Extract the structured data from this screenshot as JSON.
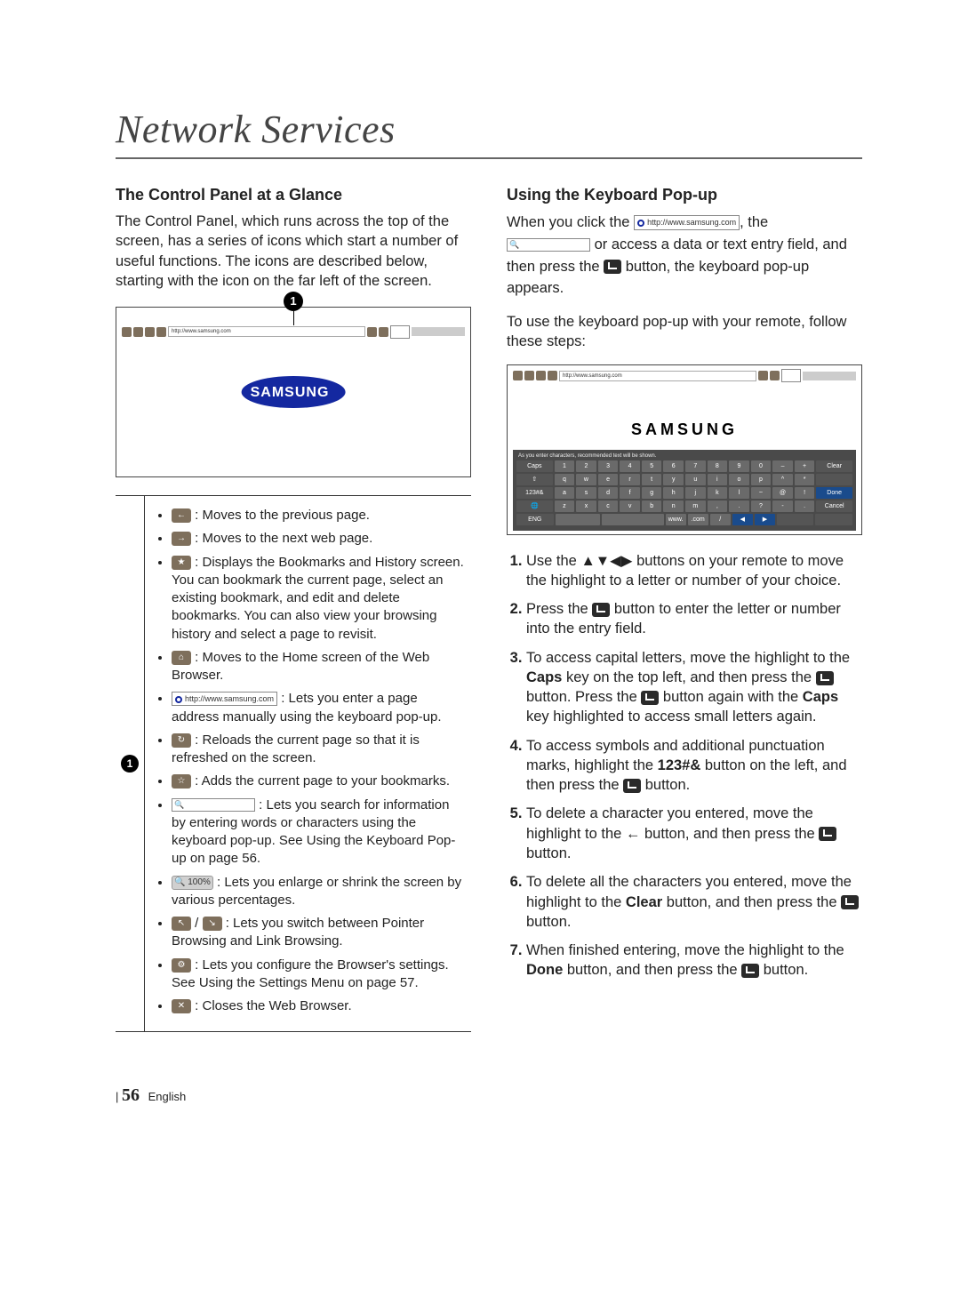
{
  "chapter": "Network Services",
  "left": {
    "heading": "The Control Panel at a Glance",
    "intro": "The Control Panel, which runs across the top of the screen, has a series of icons which start a number of useful functions. The icons are described below, starting with the icon on the far left of the screen.",
    "callout_num": "1",
    "toolbar_url": "http://www.samsung.com",
    "logo_text": "SAMSUNG",
    "list_num": "1",
    "items": {
      "i1": ": Moves to the previous page.",
      "i2": ": Moves to the next web page.",
      "i3": ": Displays the Bookmarks and History screen. You can bookmark the current page, select an existing bookmark, and edit and delete bookmarks. You can also view your browsing history and select a page to revisit.",
      "i4": ": Moves to the Home screen of the Web Browser.",
      "i5_url": "http://www.samsung.com",
      "i5": " : Lets you enter a page address manually using the keyboard pop-up.",
      "i6": ": Reloads the current page so that it is refreshed on the screen.",
      "i7": ": Adds the current page to your bookmarks.",
      "i8": " : Lets you search for information by entering words or characters using the keyboard pop-up. See Using the Keyboard Pop-up on page 56.",
      "i9_label": "100%",
      "i9": " : Lets you enlarge or shrink the screen by various percentages.",
      "i10": ": Lets you switch between Pointer Browsing and Link Browsing.",
      "i11": ": Lets you configure the Browser's settings. See Using the Settings Menu on page 57.",
      "i12": ": Closes the Web Browser."
    }
  },
  "right": {
    "heading": "Using the Keyboard Pop-up",
    "p1a": "When you click the ",
    "p1_url": "http://www.samsung.com",
    "p1b": ", the ",
    "p1c": " or access a data or text entry field, and then press the ",
    "p1d": " button, the keyboard pop-up appears.",
    "p2": "To use the keyboard pop-up with your remote, follow these steps:",
    "kbd_logo": "SAMSUNG",
    "kbd_hint": "As you enter characters, recommended text will be shown.",
    "kbd_url": "http://www.samsung.com",
    "rows": {
      "r1": [
        "Caps",
        "1",
        "2",
        "3",
        "4",
        "5",
        "6",
        "7",
        "8",
        "9",
        "0",
        "–",
        "+",
        "Clear"
      ],
      "r2": [
        "⇧",
        "q",
        "w",
        "e",
        "r",
        "t",
        "y",
        "u",
        "i",
        "o",
        "p",
        "^",
        "*",
        ""
      ],
      "r3": [
        "123#&",
        "a",
        "s",
        "d",
        "f",
        "g",
        "h",
        "j",
        "k",
        "l",
        "~",
        "@",
        "!",
        "Done"
      ],
      "r4": [
        "🌐",
        "z",
        "x",
        "c",
        "v",
        "b",
        "n",
        "m",
        ",",
        ".",
        "?",
        "-",
        ".",
        "Cancel"
      ],
      "r5": [
        "ENG",
        "",
        "",
        "",
        "",
        "",
        "www.",
        ".com",
        "/",
        "◀",
        "▶",
        "",
        "",
        ""
      ]
    },
    "steps": {
      "s1": "Use the ▲▼◀▶ buttons on your remote to move the highlight to a letter or number of your choice.",
      "s2a": "Press the ",
      "s2b": " button to enter the letter or number into the entry field.",
      "s3a": "To access capital letters, move the highlight to the ",
      "s3caps": "Caps",
      "s3b": " key on the top left, and then press the ",
      "s3c": " button. Press the ",
      "s3d": " button again with the ",
      "s3caps2": "Caps",
      "s3e": " key highlighted to access small letters again.",
      "s4a": "To access symbols and additional punctuation marks, highlight the ",
      "s4btn": "123#&",
      "s4b": " button on the left, and then press the ",
      "s4c": " button.",
      "s5a": "To delete a character you entered, move the highlight to the ",
      "s5arrow": "←",
      "s5b": " button, and then press the ",
      "s5c": " button.",
      "s6a": "To delete all the characters you entered, move the highlight to the ",
      "s6clear": "Clear",
      "s6b": " button, and then press the ",
      "s6c": " button.",
      "s7a": "When finished entering, move the highlight to the ",
      "s7done": "Done",
      "s7b": " button, and then press the ",
      "s7c": " button."
    }
  },
  "footer": {
    "page_num": "56",
    "lang": "English",
    "bar": "|"
  }
}
